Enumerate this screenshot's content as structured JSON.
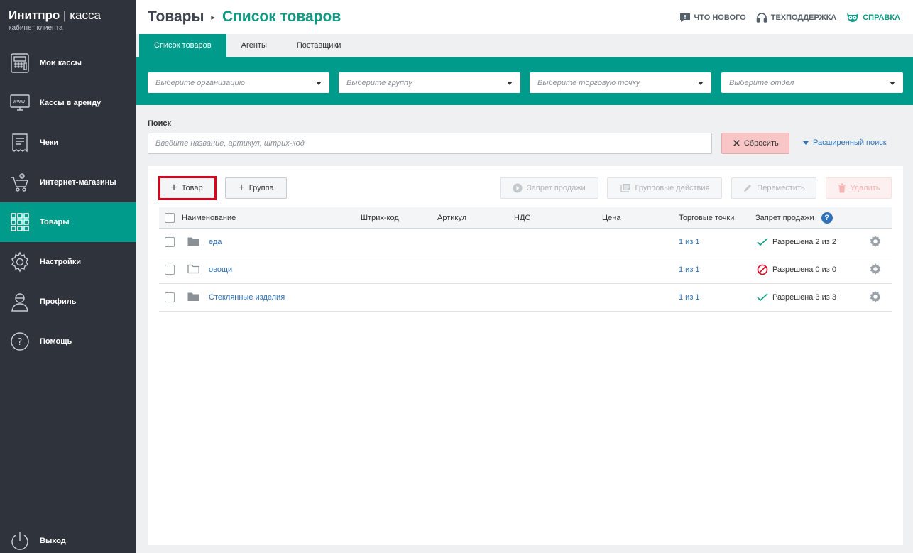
{
  "brand": {
    "name": "Инитпро",
    "separator": "|",
    "product": "касса",
    "subtitle": "кабинет клиента"
  },
  "sidebar": {
    "items": [
      {
        "label": "Мои кассы",
        "icon": "cash-register-icon"
      },
      {
        "label": "Кассы в аренду",
        "icon": "www-monitor-icon"
      },
      {
        "label": "Чеки",
        "icon": "receipt-icon"
      },
      {
        "label": "Интернет-магазины",
        "icon": "cart-icon"
      },
      {
        "label": "Товары",
        "icon": "grid-icon",
        "active": true
      },
      {
        "label": "Настройки",
        "icon": "gear-icon"
      },
      {
        "label": "Профиль",
        "icon": "user-icon"
      },
      {
        "label": "Помощь",
        "icon": "question-icon"
      }
    ],
    "logout_label": "Выход"
  },
  "header": {
    "crumb_root": "Товары",
    "crumb_current": "Список товаров",
    "links": {
      "whats_new": "ЧТО НОВОГО",
      "support": "ТЕХПОДДЕРЖКА",
      "help": "СПРАВКА"
    }
  },
  "tabs": [
    "Список товаров",
    "Агенты",
    "Поставщики"
  ],
  "filters": {
    "organization": "Выберите организацию",
    "group": "Выберите группу",
    "outlet": "Выберите торговую точку",
    "department": "Выберите отдел"
  },
  "search": {
    "label": "Поиск",
    "placeholder": "Введите название, артикул, штрих-код",
    "reset_label": "Сбросить",
    "advanced_label": "Расширенный поиск"
  },
  "toolbar": {
    "add_product": "Товар",
    "add_group": "Группа",
    "ban_sale": "Запрет продажи",
    "group_actions": "Групповые действия",
    "move": "Переместить",
    "delete": "Удалить"
  },
  "table": {
    "columns": {
      "name": "Наименование",
      "barcode": "Штрих-код",
      "article": "Артикул",
      "vat": "НДС",
      "price": "Цена",
      "outlets": "Торговые точки",
      "sale_ban": "Запрет продажи"
    },
    "rows": [
      {
        "name": "еда",
        "outlets": "1 из 1",
        "status": "Разрешена 2 из 2",
        "status_type": "allowed",
        "folder": "filled"
      },
      {
        "name": "овощи",
        "outlets": "1 из 1",
        "status": "Разрешена 0 из 0",
        "status_type": "banned",
        "folder": "outline"
      },
      {
        "name": "Стеклянные изделия",
        "outlets": "1 из 1",
        "status": "Разрешена 3 из 3",
        "status_type": "allowed",
        "folder": "filled"
      }
    ]
  },
  "colors": {
    "sidebar_bg": "#2f333c",
    "accent": "#009b8a",
    "link": "#2f72b8",
    "danger": "#e0001b"
  }
}
